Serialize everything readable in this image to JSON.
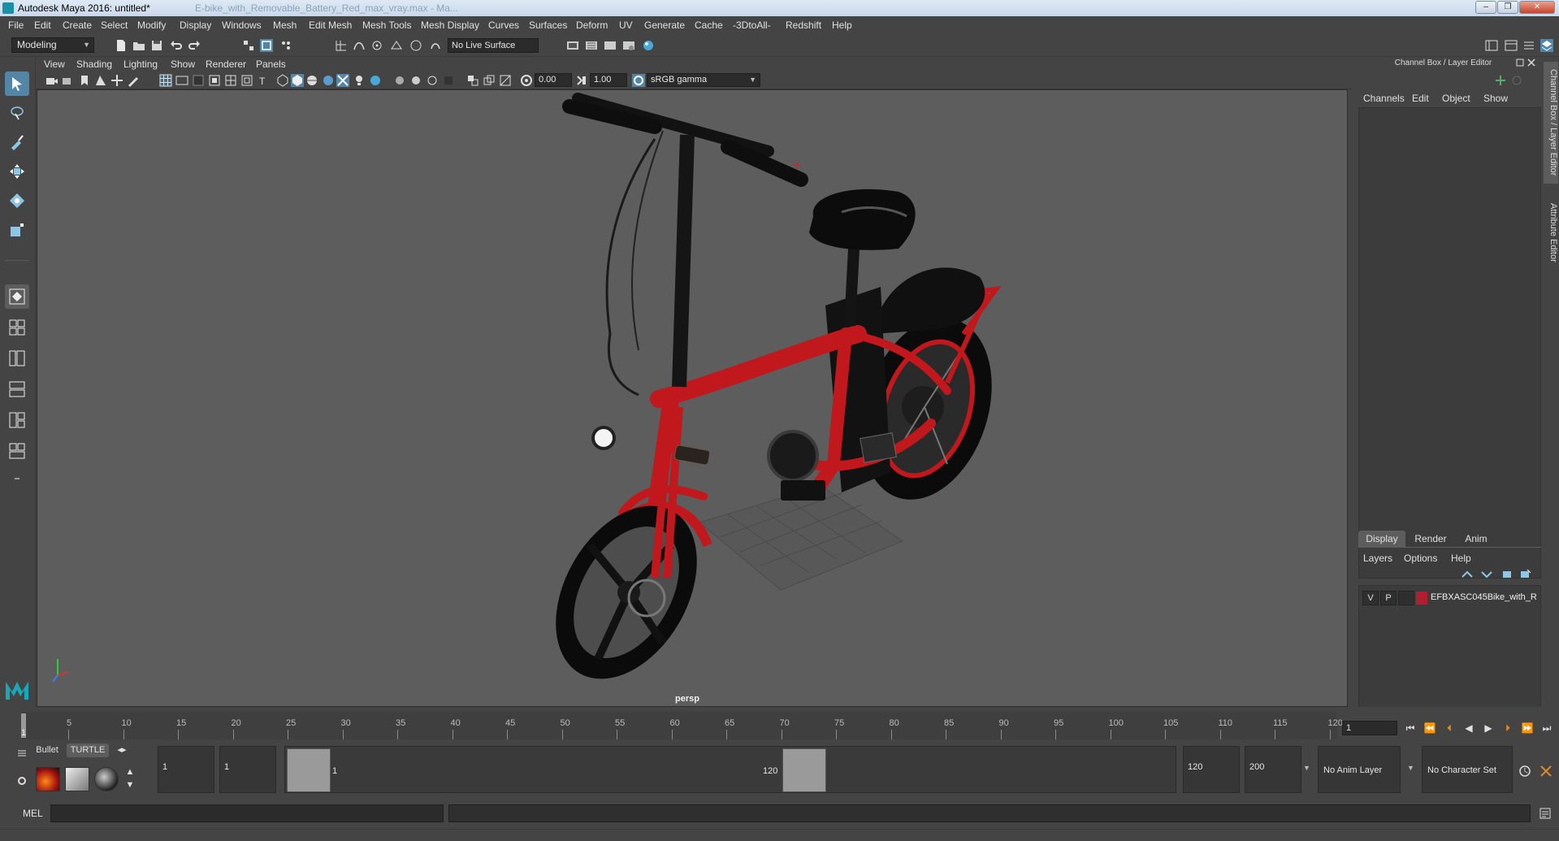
{
  "window": {
    "title": "Autodesk Maya 2016: untitled*",
    "ghost_title": "E-bike_with_Removable_Battery_Red_max_vray.max - Ma..."
  },
  "menubar": [
    "File",
    "Edit",
    "Create",
    "Select",
    "Modify",
    "Display",
    "Windows",
    "Mesh",
    "Edit Mesh",
    "Mesh Tools",
    "Mesh Display",
    "Curves",
    "Surfaces",
    "Deform",
    "UV",
    "Generate",
    "Cache",
    "-3DtoAll-",
    "Redshift",
    "Help"
  ],
  "statusline": {
    "mode": "Modeling",
    "live_surface": "No Live Surface"
  },
  "viewport": {
    "menu": [
      "View",
      "Shading",
      "Lighting",
      "Show",
      "Renderer",
      "Panels"
    ],
    "exposure": "0.00",
    "gamma": "1.00",
    "color_space": "sRGB gamma",
    "camera_label": "persp"
  },
  "channel_box": {
    "header": "Channel Box / Layer Editor",
    "menu": [
      "Channels",
      "Edit",
      "Object",
      "Show"
    ]
  },
  "layer_editor": {
    "tabs": [
      "Display",
      "Render",
      "Anim"
    ],
    "active_tab": "Display",
    "menu": [
      "Layers",
      "Options",
      "Help"
    ],
    "layers": [
      {
        "v": "V",
        "p": "P",
        "name": "EFBXASC045Bike_with_R",
        "color": "#b01f2f"
      }
    ]
  },
  "side_tabs": [
    "Channel Box / Layer Editor",
    "Attribute Editor"
  ],
  "timeline": {
    "start_label": "1",
    "ticks": [
      "5",
      "10",
      "15",
      "20",
      "25",
      "30",
      "35",
      "40",
      "45",
      "50",
      "55",
      "60",
      "65",
      "70",
      "75",
      "80",
      "85",
      "90",
      "95",
      "100",
      "105",
      "110",
      "115",
      "120"
    ],
    "current_frame": "1"
  },
  "range": {
    "shelf_tabs": [
      "Bullet",
      "TURTLE"
    ],
    "start": "1",
    "playback_start": "1",
    "range_start_label": "1",
    "range_end_label": "120",
    "playback_end": "120",
    "end": "200",
    "anim_layer": "No Anim Layer",
    "character_set": "No Character Set"
  },
  "command_line": {
    "label": "MEL"
  },
  "colors": {
    "accent": "#5285a6",
    "viewport_bg": "#5d5d5d",
    "bike_red": "#c0181c",
    "layer_color": "#b01f2f"
  }
}
